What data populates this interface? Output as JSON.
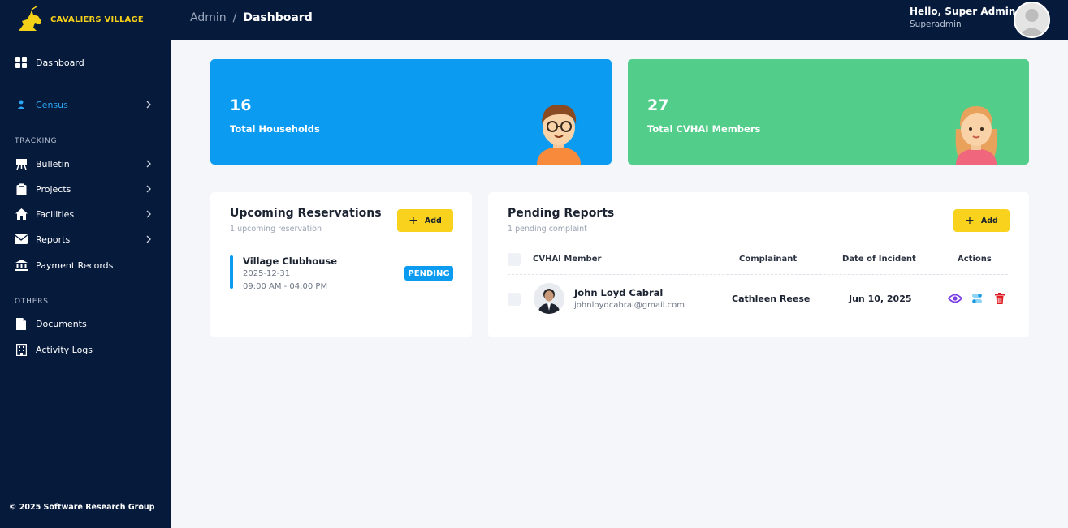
{
  "brand": {
    "name": "CAVALIERS VILLAGE",
    "logo_icon": "horseman-logo",
    "accent": "#f5d019"
  },
  "sidebar": {
    "items": [
      {
        "label": "Dashboard",
        "icon": "grid-icon"
      },
      {
        "label": "Census",
        "icon": "person-icon",
        "active": true
      },
      {
        "label": "Bulletin",
        "icon": "easel-icon"
      },
      {
        "label": "Projects",
        "icon": "clipboard-icon"
      },
      {
        "label": "Facilities",
        "icon": "house-icon"
      },
      {
        "label": "Reports",
        "icon": "mail-icon"
      },
      {
        "label": "Payment Records",
        "icon": "bank-icon"
      },
      {
        "label": "Documents",
        "icon": "file-icon"
      },
      {
        "label": "Activity Logs",
        "icon": "building-icon"
      }
    ],
    "sections": {
      "tracking": "TRACKING",
      "others": "OTHERS"
    },
    "footer": "© 2025 Software Research Group"
  },
  "header": {
    "breadcrumb": {
      "root": "Admin",
      "separator": "/",
      "current": "Dashboard"
    },
    "user": {
      "greeting": "Hello, Super Admin",
      "role": "Superadmin"
    }
  },
  "stats": [
    {
      "value": "16",
      "label": "Total Households",
      "color": "#0b9cf2"
    },
    {
      "value": "27",
      "label": "Total CVHAI Members",
      "color": "#52cd8a"
    }
  ],
  "reservations": {
    "title": "Upcoming Reservations",
    "subtitle": "1 upcoming reservation",
    "add_label": "Add",
    "items": [
      {
        "name": "Village Clubhouse",
        "date": "2025-12-31",
        "time": "09:00 AM - 04:00 PM",
        "status": "PENDING"
      }
    ]
  },
  "reports": {
    "title": "Pending Reports",
    "subtitle": "1 pending complaint",
    "add_label": "Add",
    "columns": [
      "CVHAI Member",
      "Complainant",
      "Date of Incident",
      "Actions"
    ],
    "rows": [
      {
        "member_name": "John Loyd Cabral",
        "member_email": "johnloydcabral@gmail.com",
        "complainant": "Cathleen Reese",
        "date": "Jun 10, 2025"
      }
    ],
    "action_icons": [
      "eye-icon",
      "toggle-icon",
      "trash-icon"
    ]
  }
}
